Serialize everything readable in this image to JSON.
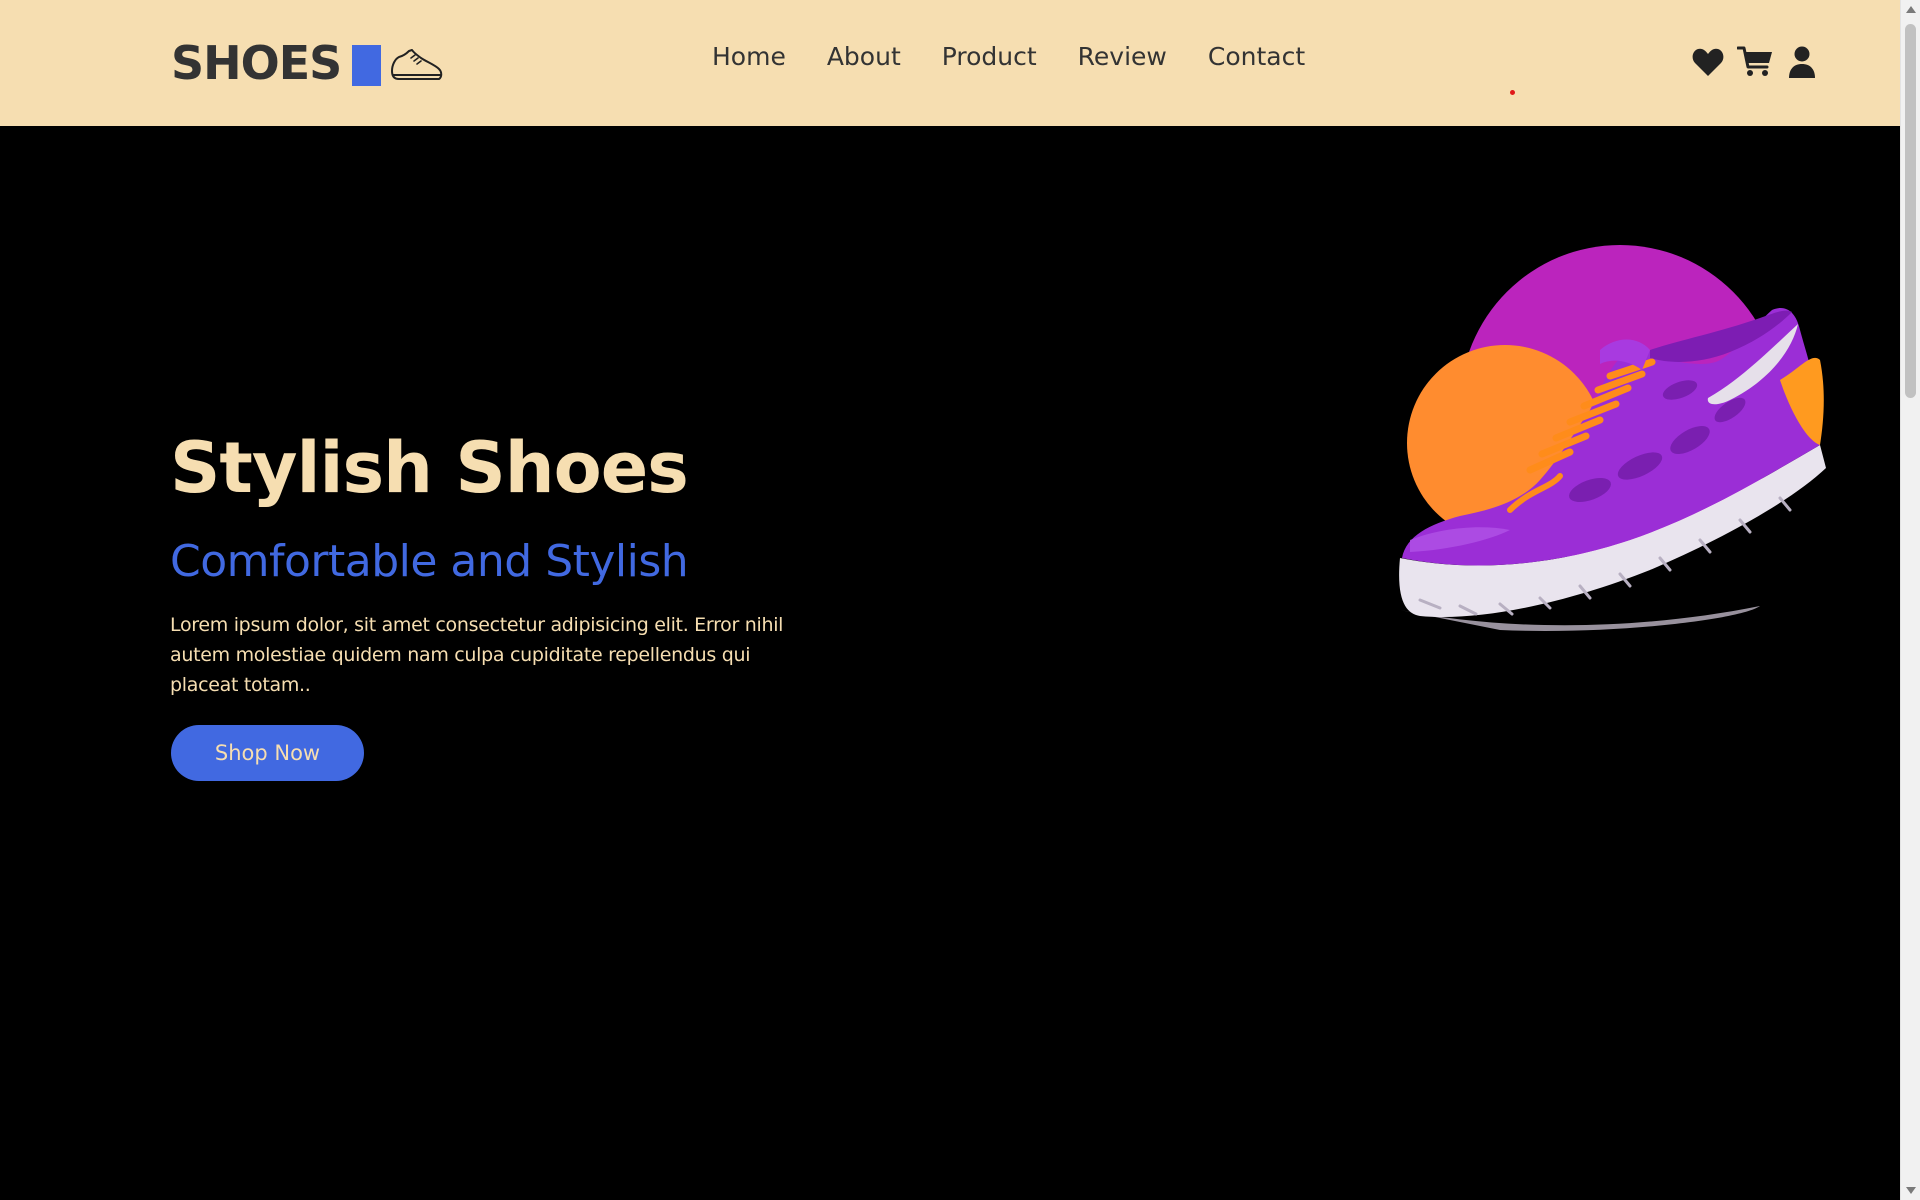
{
  "header": {
    "logo_text": "SHOES",
    "nav": [
      {
        "label": "Home"
      },
      {
        "label": "About"
      },
      {
        "label": "Product"
      },
      {
        "label": "Review"
      },
      {
        "label": "Contact"
      }
    ],
    "icons": [
      "heart-icon",
      "cart-icon",
      "user-icon"
    ]
  },
  "hero": {
    "title": "Stylish Shoes",
    "subtitle": "Comfortable and Stylish",
    "text": "Lorem ipsum dolor, sit amet consectetur adipisicing elit. Error nihil autem molestiae quidem nam culpa cupiditate repellendus qui placeat totam..",
    "button_label": "Shop Now",
    "image_alt": "shoe-image"
  },
  "colors": {
    "header_bg": "#f6deb1",
    "accent": "#4169e1",
    "text_dark": "#333333",
    "page_bg": "#000000",
    "circle_purple": "#bb24bd",
    "circle_orange": "#ff8c2f"
  }
}
